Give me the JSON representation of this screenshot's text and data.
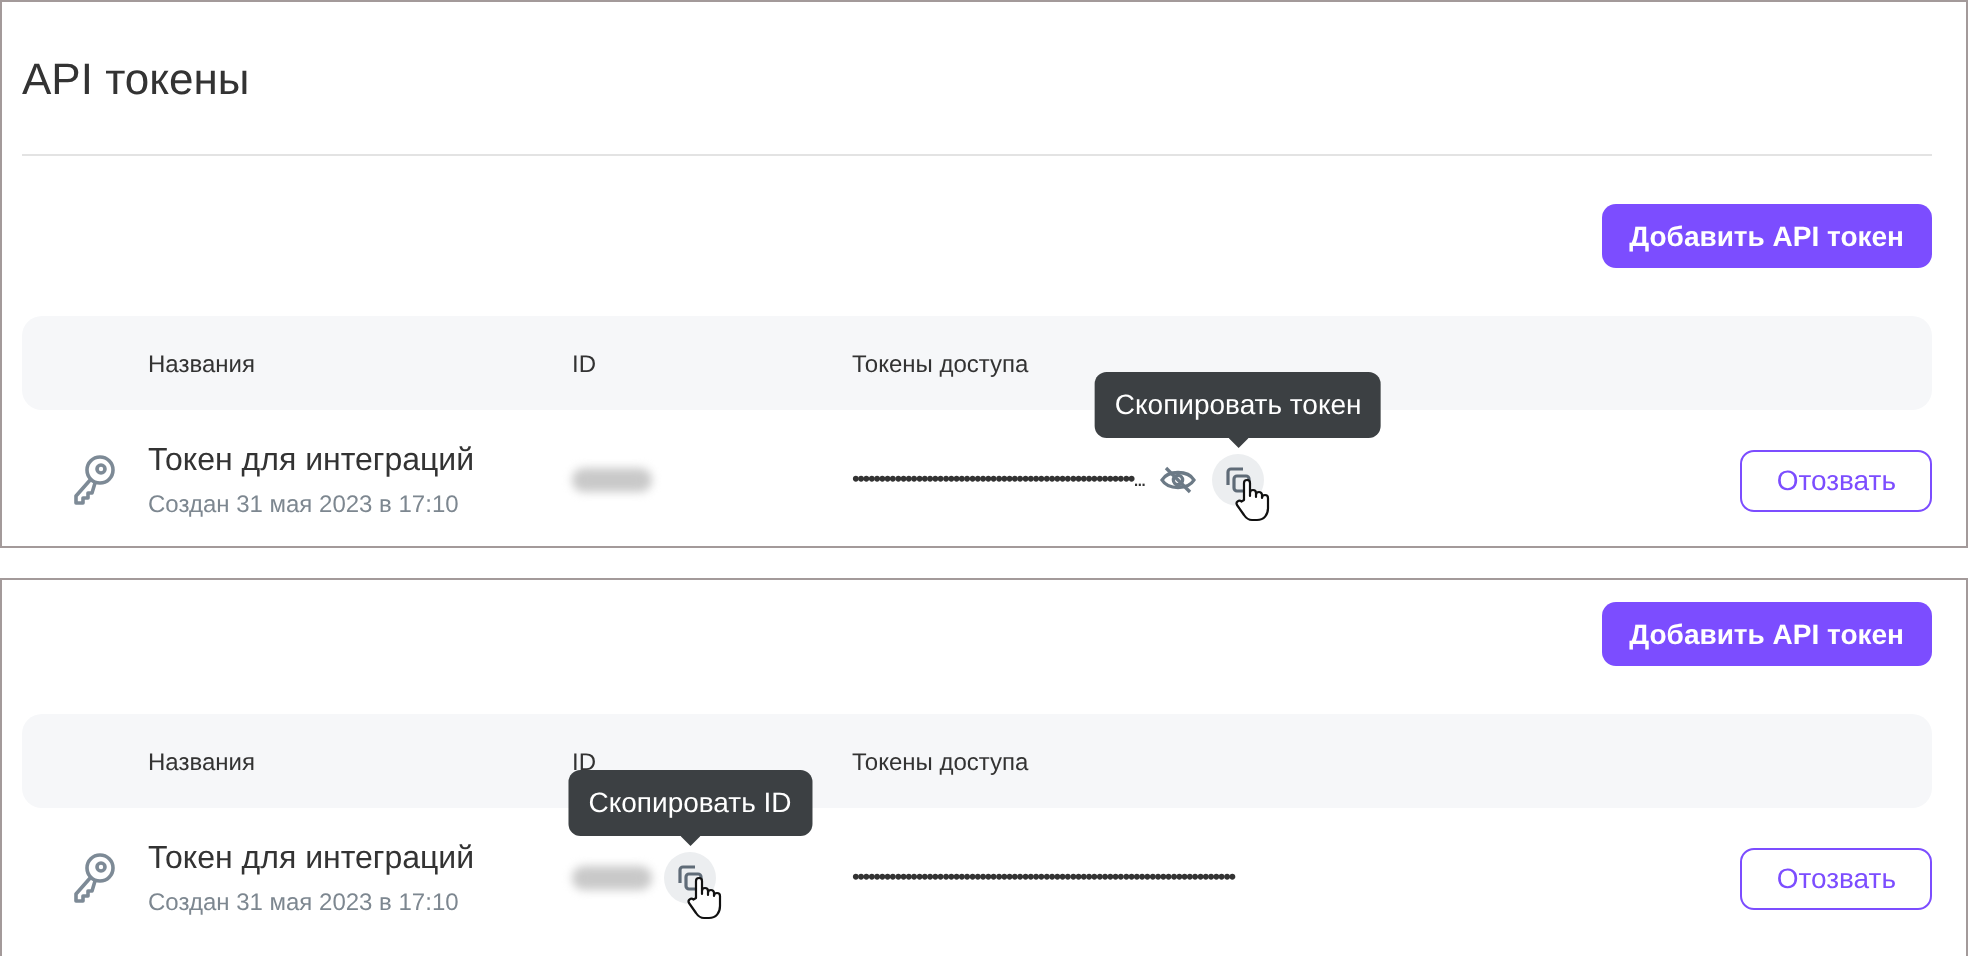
{
  "panels": [
    {
      "title": "API токены",
      "add_button": "Добавить API токен",
      "columns": [
        "Названия",
        "ID",
        "Токены доступа"
      ],
      "rows": [
        {
          "name": "Токен для интеграций",
          "created": "Создан 31 мая 2023 в 17:10",
          "token": "•••••••••••••••••••••••••••••••••••••••••••••••••••••...",
          "kind": "token",
          "tooltip": "Скопировать токен",
          "revoke_button": "Отозвать"
        }
      ]
    },
    {
      "add_button": "Добавить API токен",
      "columns": [
        "Названия",
        "ID",
        "Токены доступа"
      ],
      "rows": [
        {
          "name": "Токен для интеграций",
          "created": "Создан 31 мая 2023 в 17:10",
          "token": "••••••••••••••••••••••••••••••••••••••••••••••••••••••••••••••••••••••••",
          "kind": "id",
          "tooltip": "Скопировать ID",
          "revoke_button": "Отозвать"
        }
      ]
    }
  ]
}
